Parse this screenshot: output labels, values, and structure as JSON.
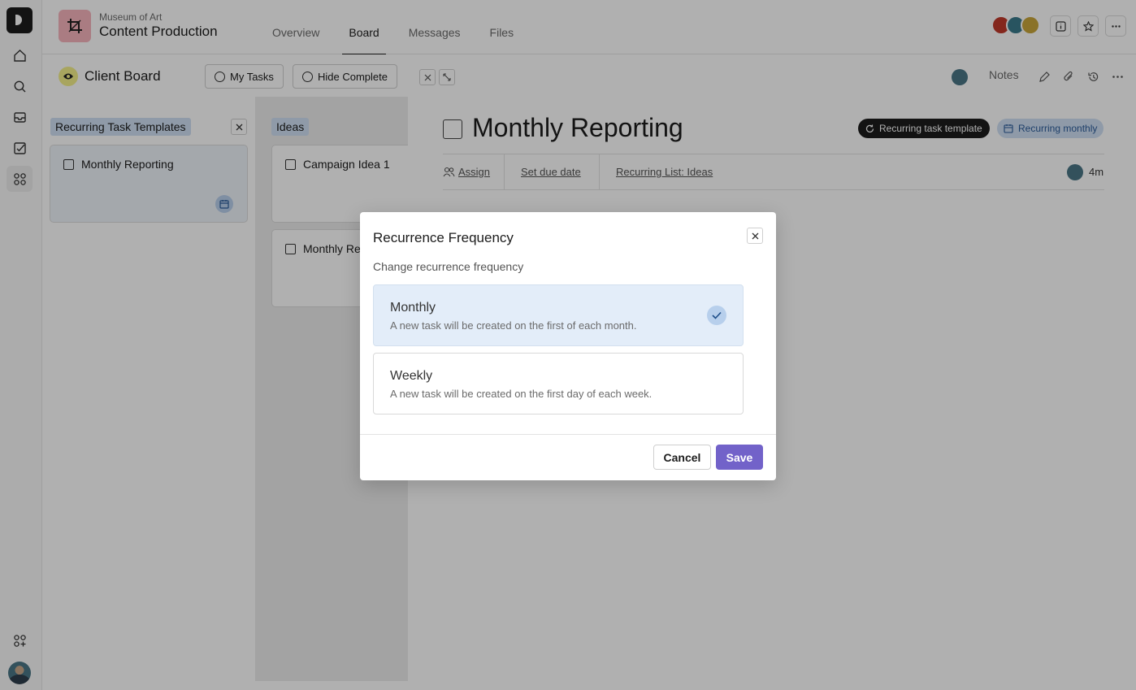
{
  "header": {
    "project_subtitle": "Museum of Art",
    "project_title": "Content Production",
    "tabs": [
      {
        "label": "Overview"
      },
      {
        "label": "Board"
      },
      {
        "label": "Messages"
      },
      {
        "label": "Files"
      }
    ],
    "active_tab": "Board"
  },
  "board": {
    "title": "Client Board",
    "my_tasks_label": "My Tasks",
    "hide_complete_label": "Hide Complete",
    "columns": [
      {
        "title": "Recurring Task Templates",
        "cards": [
          {
            "title": "Monthly Reporting"
          }
        ]
      },
      {
        "title": "Ideas",
        "cards": [
          {
            "title": "Campaign Idea 1"
          },
          {
            "title": "Monthly Re"
          }
        ]
      }
    ]
  },
  "detail": {
    "notes_label": "Notes",
    "task_title": "Monthly Reporting",
    "badge_template": "Recurring task template",
    "badge_recurring": "Recurring monthly",
    "assign_label": "Assign",
    "due_date_label": "Set due date",
    "list_label": "Recurring List: Ideas",
    "time_ago": "4m"
  },
  "modal": {
    "title": "Recurrence Frequency",
    "subtitle": "Change recurrence frequency",
    "options": [
      {
        "name": "Monthly",
        "description": "A new task will be created on the first of each month.",
        "selected": true
      },
      {
        "name": "Weekly",
        "description": "A new task will be created on the first day of each week.",
        "selected": false
      }
    ],
    "cancel_label": "Cancel",
    "save_label": "Save"
  },
  "colors": {
    "accent": "#7262c9",
    "chip_blue": "#cfe0f3",
    "project_icon": "#f6b4bd"
  }
}
